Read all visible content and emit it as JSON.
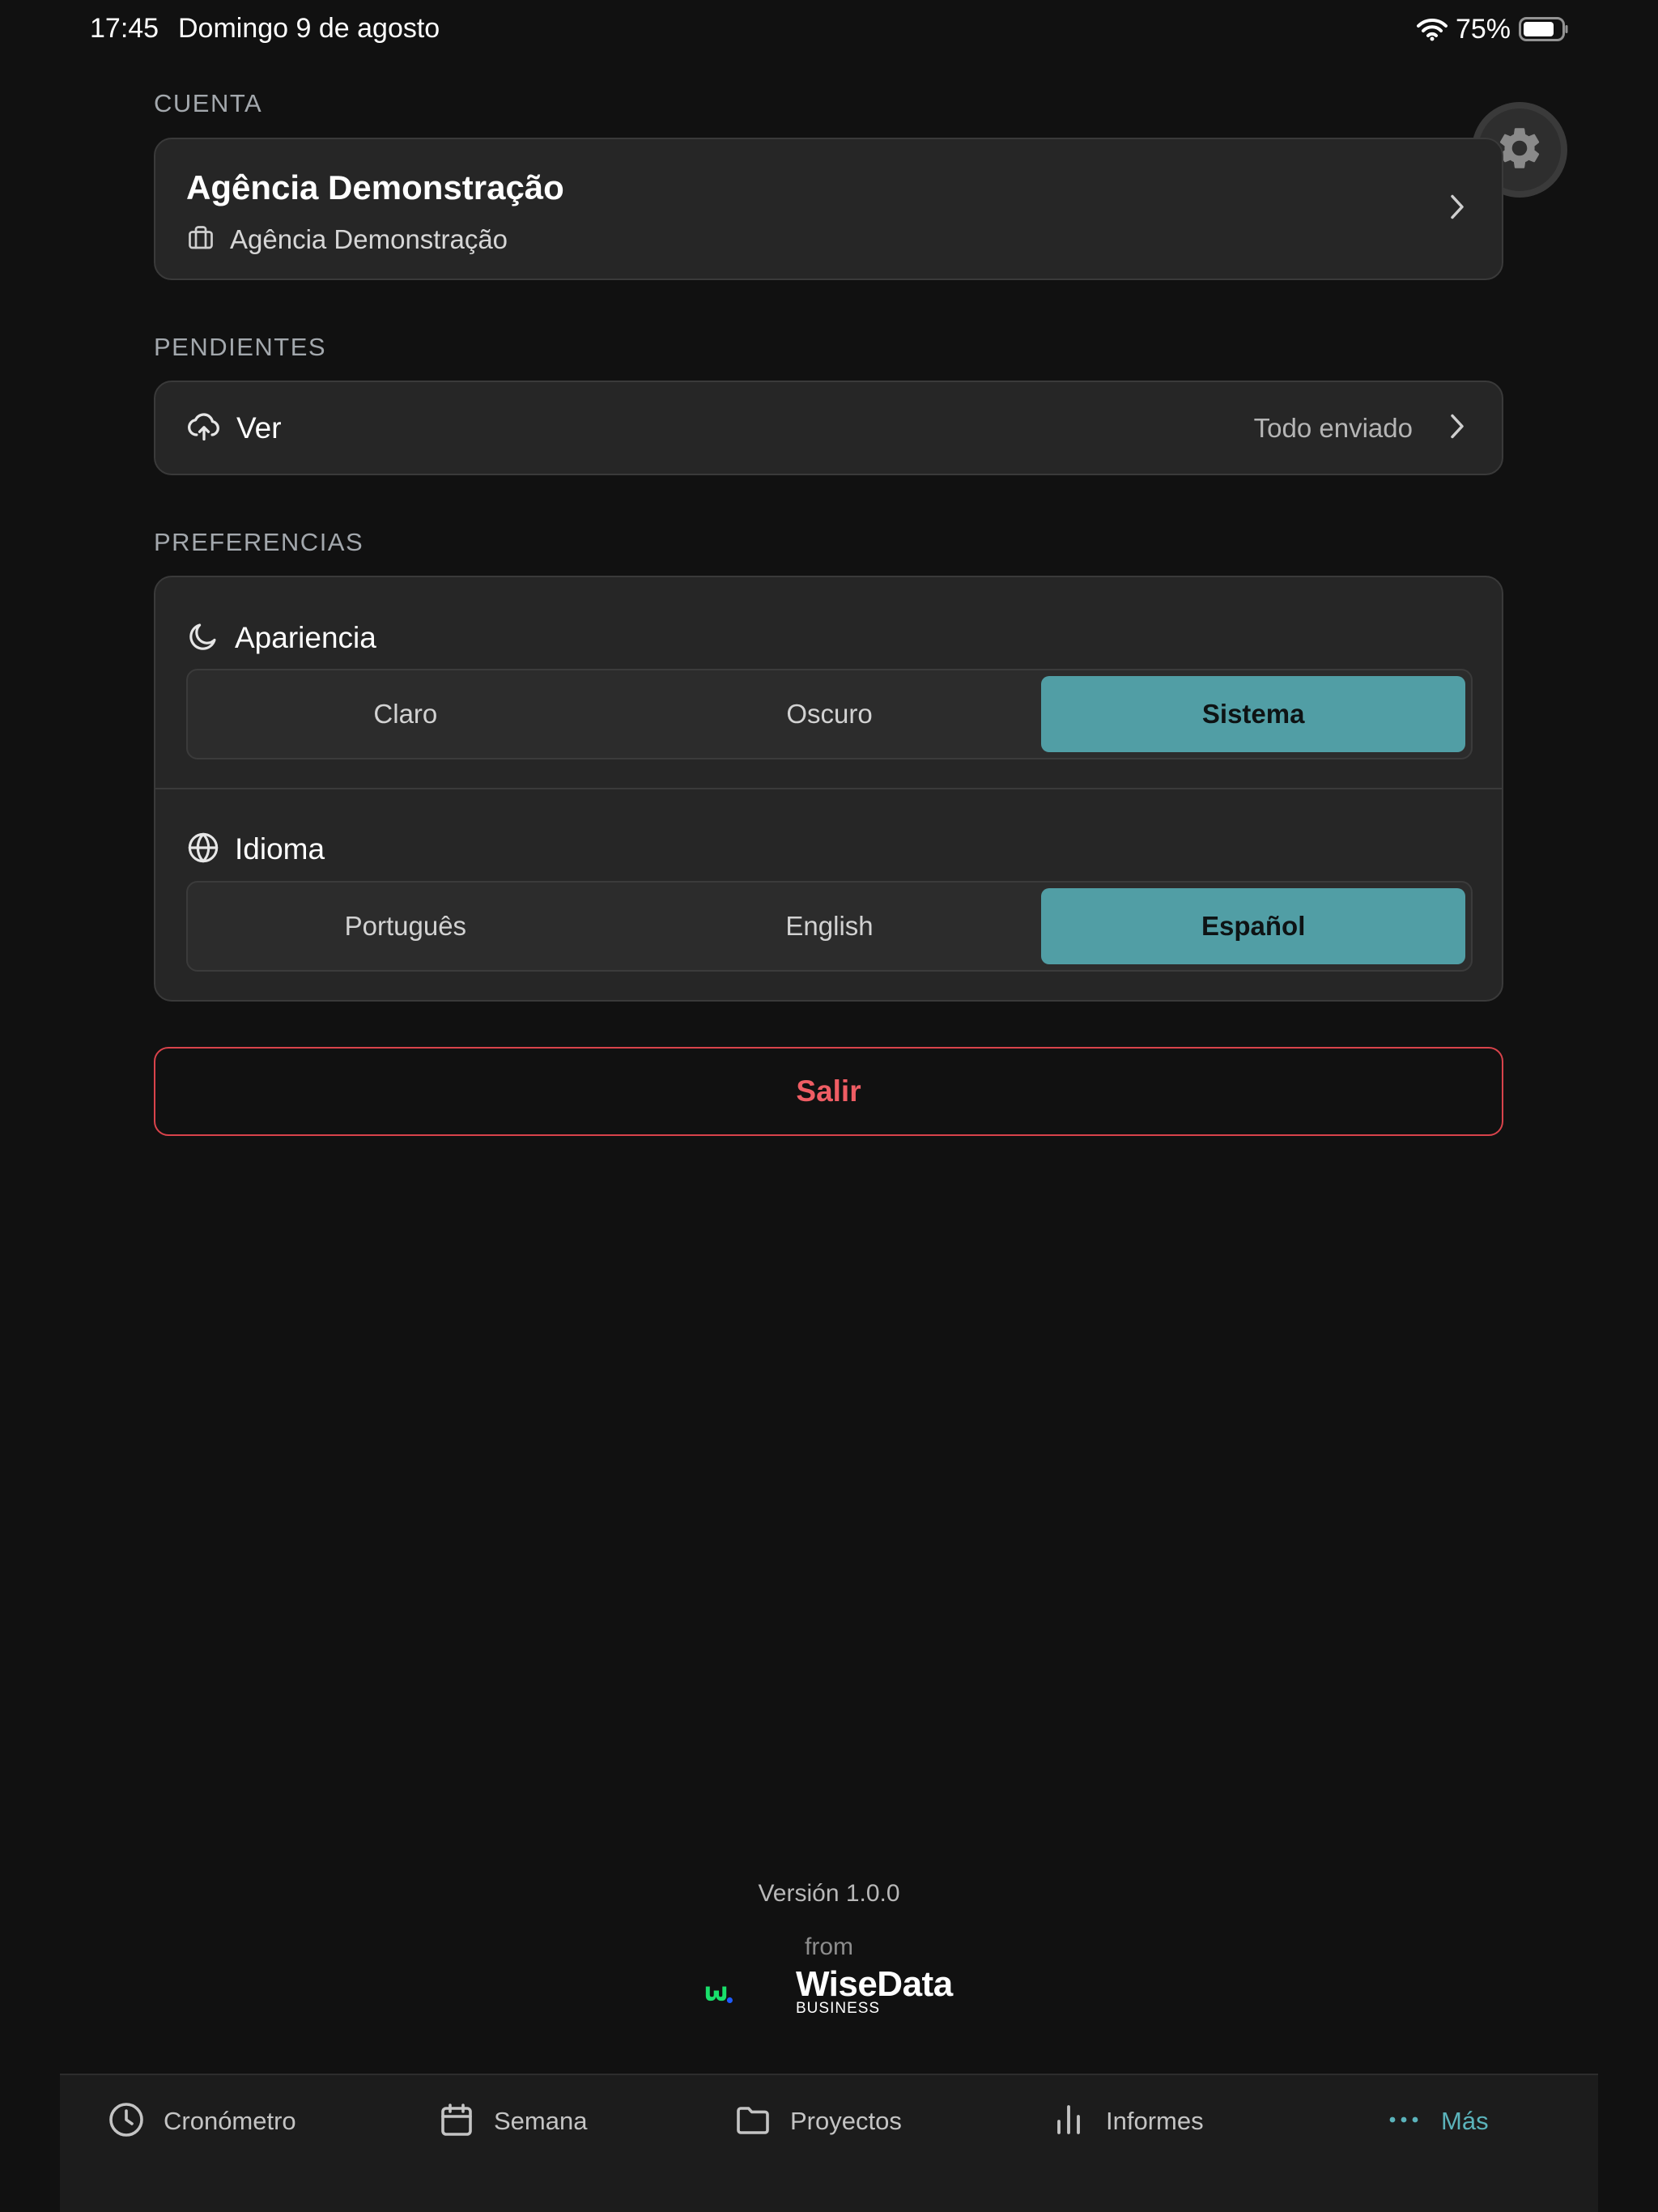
{
  "status_bar": {
    "time": "17:45",
    "date": "Domingo 9 de agosto",
    "battery": "75%",
    "icons": [
      "wifi-icon",
      "battery-icon"
    ]
  },
  "settings_button": {
    "icon": "gear-icon"
  },
  "account": {
    "section_label": "CUENTA",
    "name": "Agência Demonstração",
    "organization": "Agência Demonstração",
    "icon": "briefcase-icon"
  },
  "pending": {
    "section_label": "PENDIENTES",
    "label": "Ver",
    "status": "Todo enviado",
    "icon": "cloud-upload-icon"
  },
  "preferences": {
    "section_label": "PREFERENCIAS",
    "appearance": {
      "title": "Apariencia",
      "icon": "moon-icon",
      "options": [
        "Claro",
        "Oscuro",
        "Sistema"
      ],
      "selected": "Sistema"
    },
    "language": {
      "title": "Idioma",
      "icon": "globe-icon",
      "options": [
        "Português",
        "English",
        "Español"
      ],
      "selected": "Español"
    }
  },
  "logout": {
    "label": "Salir",
    "color": "#ef5d64"
  },
  "footer": {
    "version": "Versión 1.0.0",
    "from": "from",
    "brand": "WiseData",
    "brand_sub": "BUSINESS"
  },
  "tab_bar": {
    "tabs": [
      {
        "label": "Cronómetro",
        "icon": "clock-icon"
      },
      {
        "label": "Semana",
        "icon": "calendar-icon"
      },
      {
        "label": "Proyectos",
        "icon": "folder-icon"
      },
      {
        "label": "Informes",
        "icon": "bar-chart-icon"
      },
      {
        "label": "Más",
        "icon": "more-dots-icon"
      }
    ],
    "active": "Más"
  },
  "colors": {
    "accent": "#519ea5",
    "active_tab": "#5bb3bb",
    "danger": "#d9434b",
    "background": "#111111",
    "card": "#262626",
    "brand_green": "#19e06b",
    "brand_blue": "#1f5bff"
  }
}
